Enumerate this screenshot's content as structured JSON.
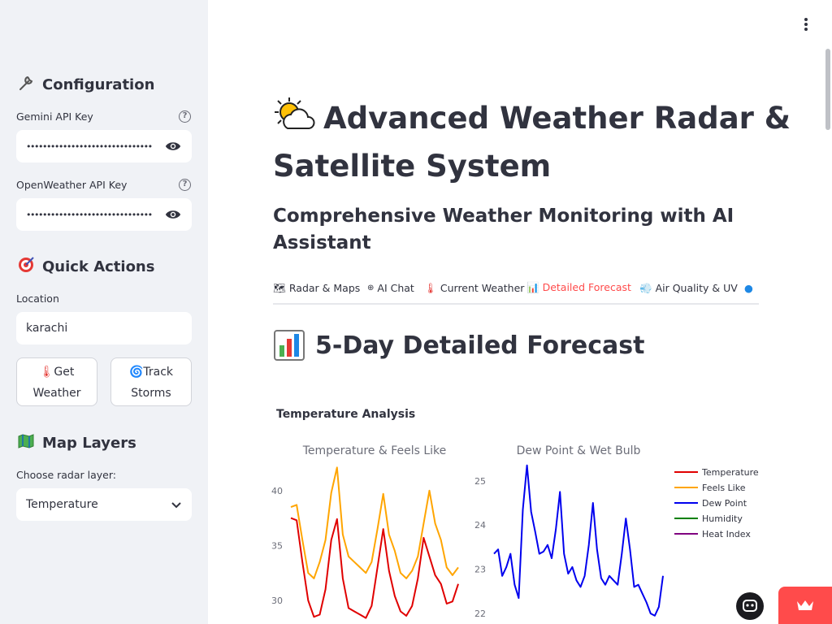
{
  "sidebar": {
    "configuration_heading": "Configuration",
    "gemini_label": "Gemini API Key",
    "gemini_value": "•••••••••••••••••••••••••••••••",
    "openweather_label": "OpenWeather API Key",
    "openweather_value": "•••••••••••••••••••••••••••••••",
    "quick_actions_heading": "Quick Actions",
    "location_label": "Location",
    "location_value": "karachi",
    "get_weather_button": "Get Weather",
    "track_storms_button": "Track Storms",
    "map_layers_heading": "Map Layers",
    "radar_layer_label": "Choose radar layer:",
    "radar_layer_value": "Temperature"
  },
  "main": {
    "title": "Advanced Weather Radar & Satellite System",
    "subtitle": "Comprehensive Weather Monitoring with AI Assistant",
    "tabs": [
      {
        "icon": "🗺",
        "label": "Radar & Maps"
      },
      {
        "icon": "⊕",
        "label": "AI Chat"
      },
      {
        "icon": "🌡",
        "label": "Current Weather"
      },
      {
        "icon": "📊",
        "label": "Detailed Forecast"
      },
      {
        "icon": "💨",
        "label": "Air Quality & UV"
      }
    ],
    "active_tab": "Detailed Forecast",
    "section_heading": "5-Day Detailed Forecast",
    "chart_caption": "Temperature Analysis"
  },
  "colors": {
    "accent": "#ff4b4b",
    "sidebar_bg": "#f0f2f6",
    "temperature": "#e00000",
    "feels_like": "#ffa500",
    "dew_point": "#0000ee",
    "humidity": "#008000",
    "heat_index": "#800080"
  },
  "chart_data": [
    {
      "type": "line",
      "title": "Temperature & Feels Like",
      "x": [
        0,
        1,
        2,
        3,
        4,
        5,
        6,
        7,
        8,
        9,
        10,
        11,
        12,
        13,
        14,
        15,
        16,
        17,
        18,
        19,
        20,
        21,
        22,
        23,
        24,
        25,
        26,
        27,
        28,
        29
      ],
      "ylim": [
        28,
        42.5
      ],
      "yticks": [
        30,
        35,
        40
      ],
      "series": [
        {
          "name": "Temperature",
          "color": "#e00000",
          "values": [
            37.5,
            37.3,
            33.5,
            30,
            28.5,
            28.7,
            31,
            35.5,
            37.4,
            32,
            29.3,
            29,
            28.7,
            28.4,
            29.5,
            33,
            36.5,
            32.7,
            30.4,
            29,
            28.6,
            29.5,
            32,
            35.7,
            34,
            32.3,
            31.5,
            29.7,
            29.9,
            31.5
          ]
        },
        {
          "name": "Feels Like",
          "color": "#ffa500",
          "values": [
            38.5,
            38.7,
            35.5,
            32.5,
            32,
            33.5,
            35.5,
            39.8,
            42.1,
            36,
            34,
            33.5,
            33,
            32.5,
            33.5,
            36.5,
            39.7,
            36,
            34.5,
            32.5,
            32,
            32.7,
            34,
            37,
            40,
            37,
            35.5,
            33,
            32.3,
            33
          ]
        }
      ]
    },
    {
      "type": "line",
      "title": "Dew Point & Wet Bulb",
      "x": [
        0,
        1,
        2,
        3,
        4,
        5,
        6,
        7,
        8,
        9,
        10,
        11,
        12,
        13,
        14,
        15,
        16,
        17,
        18,
        19,
        20,
        21,
        22,
        23,
        24,
        25,
        26,
        27,
        28,
        29,
        30,
        31,
        32,
        33,
        34,
        35,
        36,
        37,
        38,
        39,
        40,
        41
      ],
      "ylim": [
        21.8,
        25.4
      ],
      "yticks": [
        22,
        23,
        24,
        25
      ],
      "series": [
        {
          "name": "Dew Point",
          "color": "#0000ee",
          "values": [
            23.35,
            23.45,
            22.85,
            23.05,
            23.35,
            22.65,
            22.35,
            24.35,
            25.35,
            24.3,
            23.85,
            23.35,
            23.4,
            23.55,
            23.25,
            23.9,
            24.75,
            23.35,
            22.9,
            23.05,
            22.75,
            22.6,
            22.85,
            23.55,
            24.5,
            23.45,
            22.8,
            22.65,
            22.85,
            22.75,
            22.65,
            23.35,
            24.15,
            23.45,
            22.6,
            22.65,
            22.45,
            22.25,
            22.0,
            21.95,
            22.15,
            22.85
          ]
        },
        {
          "name": "Humidity",
          "color": "#008000",
          "values": []
        },
        {
          "name": "Heat Index",
          "color": "#800080",
          "values": []
        }
      ]
    }
  ]
}
